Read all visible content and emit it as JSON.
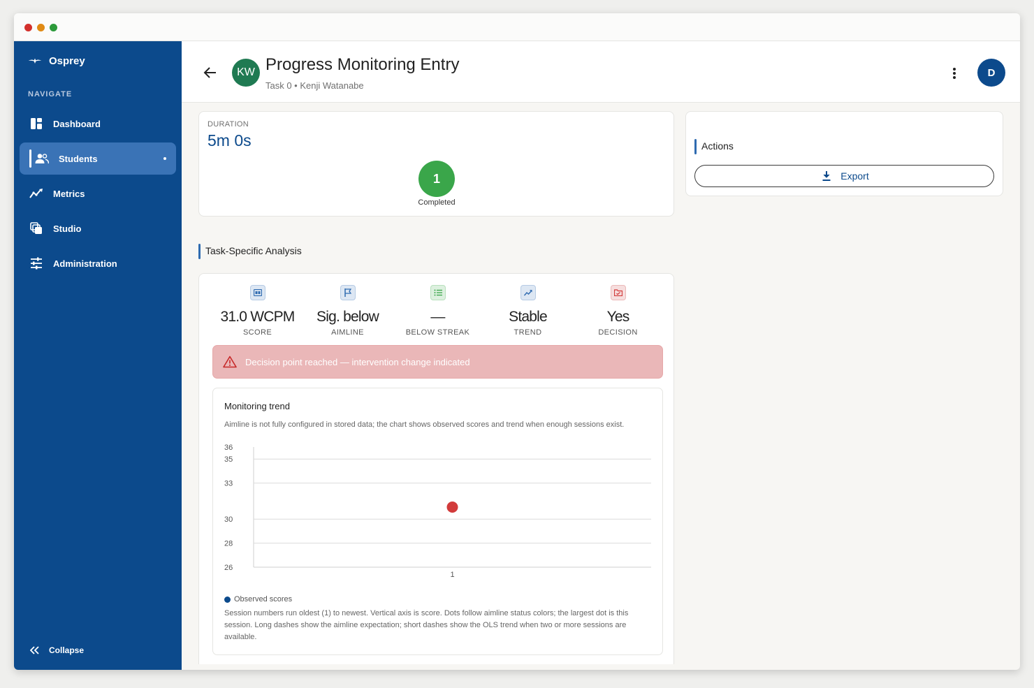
{
  "app": {
    "name": "Osprey"
  },
  "sidebar": {
    "heading": "NAVIGATE",
    "items": [
      {
        "label": "Dashboard",
        "icon": "dashboard-icon",
        "active": false
      },
      {
        "label": "Students",
        "icon": "people-icon",
        "active": true
      },
      {
        "label": "Metrics",
        "icon": "metrics-icon",
        "active": false
      },
      {
        "label": "Studio",
        "icon": "studio-icon",
        "active": false
      },
      {
        "label": "Administration",
        "icon": "sliders-icon",
        "active": false
      }
    ],
    "collapse_label": "Collapse"
  },
  "header": {
    "avatar_initials": "KW",
    "title": "Progress Monitoring Entry",
    "subtitle": "Task 0 • Kenji Watanabe",
    "user_initial": "D"
  },
  "duration": {
    "label": "DURATION",
    "value": "5m 0s",
    "completed_count": "1",
    "completed_label": "Completed"
  },
  "actions": {
    "title": "Actions",
    "export_label": "Export"
  },
  "analysis": {
    "title": "Task-Specific Analysis",
    "metrics": [
      {
        "value": "31.0 WCPM",
        "label": "SCORE",
        "icon": "score-icon",
        "color": "#2f6bb0"
      },
      {
        "value": "Sig. below",
        "label": "AIMLINE",
        "icon": "flag-icon",
        "color": "#2f6bb0"
      },
      {
        "value": "—",
        "label": "BELOW STREAK",
        "icon": "list-icon",
        "color": "#3aa64a"
      },
      {
        "value": "Stable",
        "label": "TREND",
        "icon": "trend-icon",
        "color": "#2f6bb0"
      },
      {
        "value": "Yes",
        "label": "DECISION",
        "icon": "folder-icon",
        "color": "#d23b3b"
      }
    ],
    "alert": "Decision point reached — intervention change indicated"
  },
  "trend": {
    "title": "Monitoring trend",
    "description": "Aimline is not fully configured in stored data; the chart shows observed scores and trend when enough sessions exist.",
    "legend": "Observed scores",
    "note": "Session numbers run oldest (1) to newest. Vertical axis is score. Dots follow aimline status colors; the largest dot is this session. Long dashes show the aimline expectation; short dashes show the OLS trend when two or more sessions are available."
  },
  "chart_data": {
    "type": "scatter",
    "title": "Monitoring trend",
    "xlabel": "",
    "ylabel": "",
    "x_ticks": [
      "1"
    ],
    "y_ticks": [
      26,
      28,
      30,
      33,
      35,
      36
    ],
    "ylim": [
      26,
      36
    ],
    "grid": true,
    "series": [
      {
        "name": "Observed scores",
        "x": [
          1
        ],
        "y": [
          31.0
        ],
        "color": "#d23b3b"
      }
    ]
  },
  "colors": {
    "sidebar": "#0c4a8c",
    "active": "#3a73b6",
    "accent": "#2f6bb0",
    "alert_bg": "#eab7b8",
    "completed": "#3aa64a"
  }
}
